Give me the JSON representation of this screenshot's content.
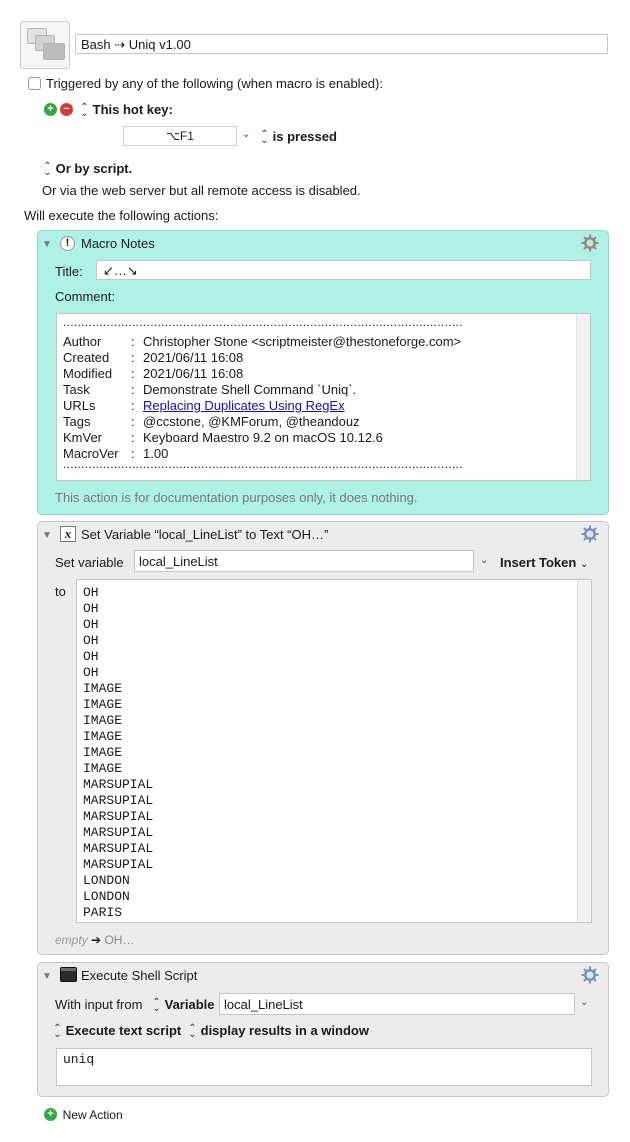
{
  "macro": {
    "title": "Bash ⇢ Uniq v1.00",
    "icon": "macro-group-icon"
  },
  "trigger": {
    "triggered_label": "Triggered by any of the following (when macro is enabled):",
    "hotkey_label": "This hot key:",
    "hotkey_value": "⌥F1",
    "is_pressed_label": "is pressed",
    "or_by_script_label": "Or by script.",
    "web_server_text": "Or via the web server but all remote access is disabled."
  },
  "will_execute_label": "Will execute the following actions:",
  "notes_action": {
    "title": "Macro Notes",
    "title_label": "Title:",
    "title_value": "↙…↘",
    "comment_label": "Comment:",
    "dotted_line": "..............................................................................................................",
    "rows": [
      {
        "key": "Author",
        "value": "Christopher Stone <scriptmeister@thestoneforge.com>"
      },
      {
        "key": "Created",
        "value": "2021/06/11 16:08"
      },
      {
        "key": "Modified",
        "value": "2021/06/11 16:08"
      },
      {
        "key": "Task",
        "value": "Demonstrate Shell Command `Uniq`."
      },
      {
        "key": "URLs",
        "value": "Replacing Duplicates Using RegEx"
      },
      {
        "key": "Tags",
        "value": "@ccstone, @KMForum, @theandouz"
      },
      {
        "key": "KmVer",
        "value": "Keyboard Maestro 9.2 on macOS 10.12.6"
      },
      {
        "key": "MacroVer",
        "value": "1.00"
      }
    ],
    "separator": ":",
    "footer": "This action is for documentation purposes only, it does nothing."
  },
  "setvar_action": {
    "title": "Set Variable “local_LineList” to Text “OH…”",
    "set_variable_label": "Set variable",
    "variable_name": "local_LineList",
    "insert_token_label": "Insert Token",
    "to_label": "to",
    "lines": [
      "OH",
      "OH",
      "OH",
      "OH",
      "OH",
      "OH",
      "IMAGE",
      "IMAGE",
      "IMAGE",
      "IMAGE",
      "IMAGE",
      "IMAGE",
      "MARSUPIAL",
      "MARSUPIAL",
      "MARSUPIAL",
      "MARSUPIAL",
      "MARSUPIAL",
      "MARSUPIAL",
      "LONDON",
      "LONDON",
      "PARIS"
    ],
    "footer_empty": "empty",
    "footer_arrow": "➔",
    "footer_value": "OH…"
  },
  "shell_action": {
    "title": "Execute Shell Script",
    "with_input_label": "With input from",
    "input_type": "Variable",
    "input_variable": "local_LineList",
    "execute_mode": "Execute text script",
    "display_mode": "display results in a window",
    "script": "uniq"
  },
  "new_action_label": "New Action"
}
